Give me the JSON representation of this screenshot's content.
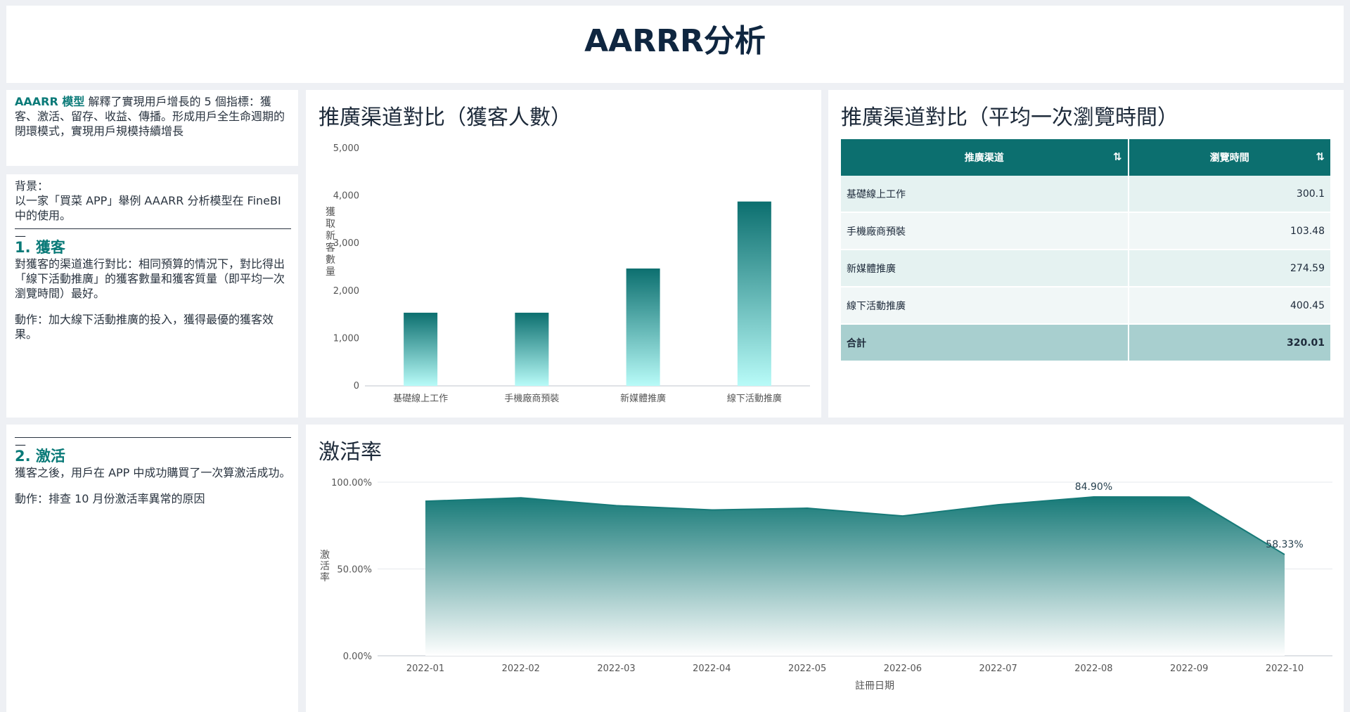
{
  "header": {
    "title": "AARRR分析"
  },
  "intro": {
    "highlight": "AAARR 模型",
    "text": " 解釋了實現用戶增長的 5 個指標：獲客、激活、留存、收益、傳播。形成用戶全生命週期的閉環模式，實現用戶規模持續增長"
  },
  "notes1": {
    "bg_label": "背景：",
    "bg_text": "以一家「買菜 APP」舉例 AAARR 分析模型在 FineBI 中的使用。",
    "rule_tail": "—",
    "heading": "1. 獲客",
    "body": "對獲客的渠道進行對比：相同預算的情況下，對比得出「線下活動推廣」的獲客數量和獲客質量（即平均一次瀏覽時間）最好。",
    "action": "動作：加大線下活動推廣的投入，獲得最優的獲客效果。"
  },
  "notes2": {
    "rule_tail": "—",
    "heading": "2. 激活",
    "body": "獲客之後，用戶在 APP 中成功購買了一次算激活成功。",
    "action": "動作：排查 10 月份激活率異常的原因"
  },
  "bar_panel": {
    "title": "推廣渠道對比（獲客人數）"
  },
  "table_panel": {
    "title": "推廣渠道對比（平均一次瀏覽時間）",
    "headers": [
      "推廣渠道",
      "瀏覽時間"
    ],
    "sort_icon": "⇅",
    "rows": [
      {
        "channel": "基礎線上工作",
        "time": "300.1"
      },
      {
        "channel": "手機廠商預裝",
        "time": "103.48"
      },
      {
        "channel": "新媒體推廣",
        "time": "274.59"
      },
      {
        "channel": "線下活動推廣",
        "time": "400.45"
      }
    ],
    "total_label": "合計",
    "total_value": "320.01"
  },
  "area_panel": {
    "title": "激活率"
  },
  "colors": {
    "accent": "#0c6f6f",
    "highlight": "#0a7a78"
  },
  "chart_data": [
    {
      "type": "bar",
      "title": "推廣渠道對比（獲客人數）",
      "categories": [
        "基礎線上工作",
        "手機廠商預裝",
        "新媒體推廣",
        "線下活動推廣"
      ],
      "values": [
        1540,
        1540,
        2470,
        3880
      ],
      "ylabel": "獲取新客數量",
      "xlabel": "",
      "ylim": [
        0,
        5000
      ],
      "yticks": [
        "0",
        "1,000",
        "2,000",
        "3,000",
        "4,000",
        "5,000"
      ],
      "grid": false
    },
    {
      "type": "area",
      "title": "激活率",
      "x": [
        "2022-01",
        "2022-02",
        "2022-03",
        "2022-04",
        "2022-05",
        "2022-06",
        "2022-07",
        "2022-08",
        "2022-09",
        "2022-10"
      ],
      "values": [
        0.89,
        0.91,
        0.865,
        0.84,
        0.85,
        0.805,
        0.87,
        0.915,
        0.914,
        0.5833
      ],
      "labels": {
        "7": "84.90%",
        "9": "58.33%"
      },
      "ylabel": "激活率",
      "xlabel": "註冊日期",
      "ylim": [
        0,
        1
      ],
      "yticks": [
        "0.00%",
        "50.00%",
        "100.00%"
      ],
      "grid": true
    }
  ]
}
